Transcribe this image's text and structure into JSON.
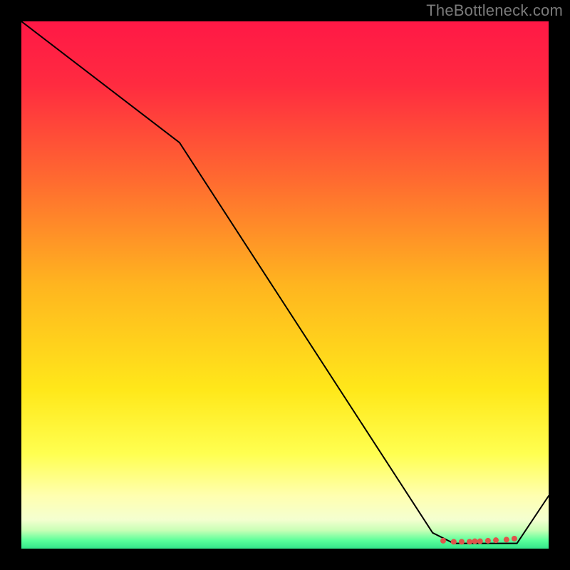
{
  "watermark": "TheBottleneck.com",
  "chart_data": {
    "type": "line",
    "title": "",
    "xlabel": "",
    "ylabel": "",
    "xlim": [
      0,
      100
    ],
    "ylim": [
      0,
      100
    ],
    "grid": false,
    "legend": false,
    "background_gradient_stops": [
      {
        "offset": 0.0,
        "color": "#ff1846"
      },
      {
        "offset": 0.12,
        "color": "#ff2b40"
      },
      {
        "offset": 0.3,
        "color": "#ff6a30"
      },
      {
        "offset": 0.5,
        "color": "#ffb51f"
      },
      {
        "offset": 0.7,
        "color": "#ffe81a"
      },
      {
        "offset": 0.82,
        "color": "#ffff50"
      },
      {
        "offset": 0.9,
        "color": "#ffffb0"
      },
      {
        "offset": 0.945,
        "color": "#f4ffd0"
      },
      {
        "offset": 0.965,
        "color": "#c9ffb6"
      },
      {
        "offset": 0.985,
        "color": "#58ff9a"
      },
      {
        "offset": 1.0,
        "color": "#33e58a"
      }
    ],
    "series": [
      {
        "name": "bottleneck-curve",
        "x": [
          0,
          30,
          78,
          82,
          88,
          94,
          100
        ],
        "y": [
          100,
          77,
          3,
          1,
          1,
          1,
          10
        ],
        "stroke": "#000000",
        "stroke_width": 2
      }
    ],
    "markers": {
      "name": "optimal-range-dots",
      "x": [
        80,
        82,
        83.5,
        85,
        86,
        87,
        88.5,
        90,
        92,
        93.5
      ],
      "y": [
        1.5,
        1.3,
        1.3,
        1.3,
        1.4,
        1.4,
        1.5,
        1.6,
        1.7,
        1.9
      ],
      "color": "#e0544a",
      "radius": 4
    }
  }
}
